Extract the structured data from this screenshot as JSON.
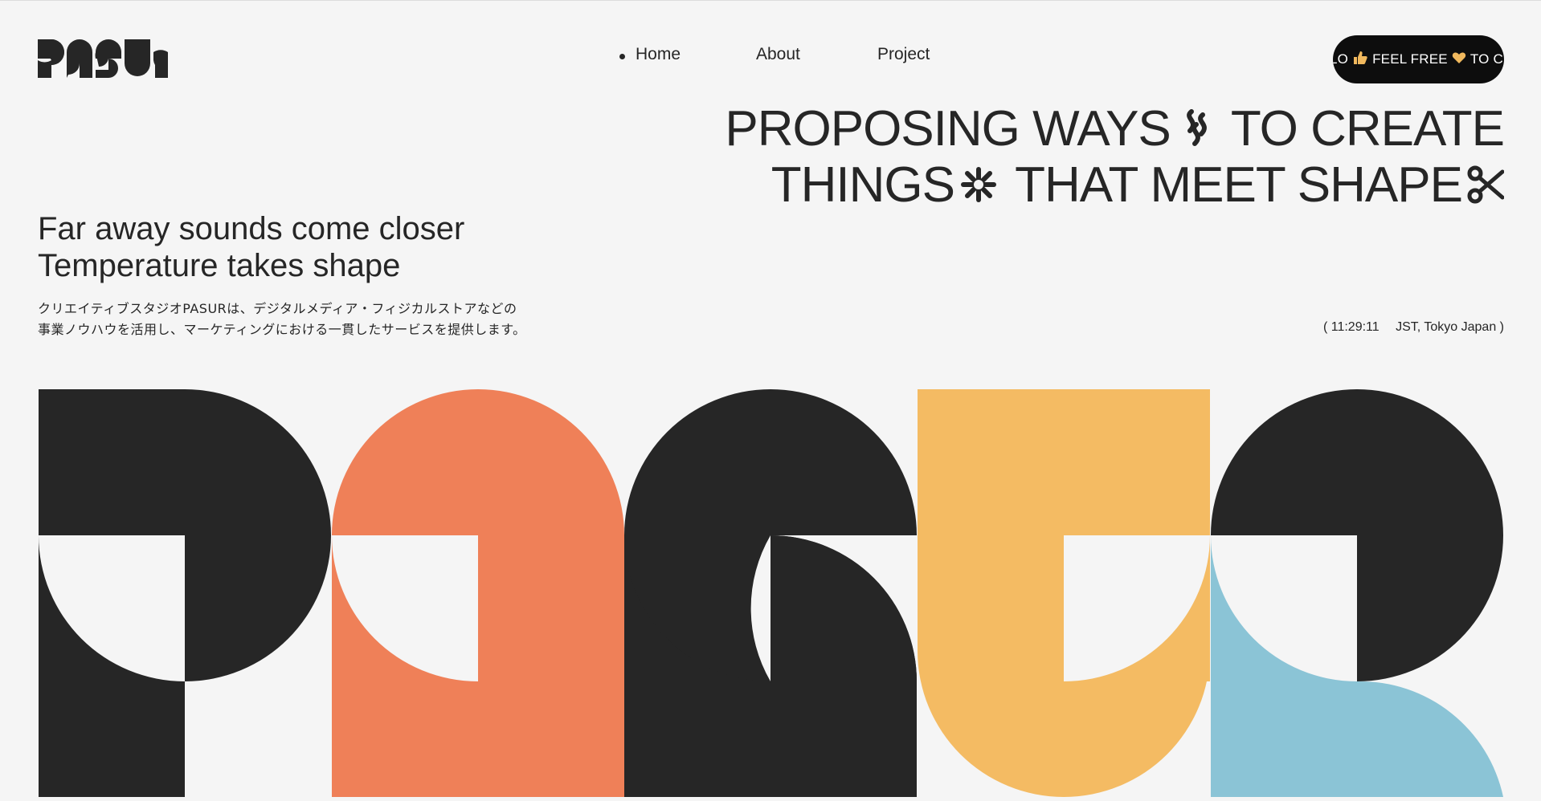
{
  "brand": {
    "logo_text": "PASUR"
  },
  "nav": {
    "items": [
      {
        "label": "Home",
        "active": true
      },
      {
        "label": "About",
        "active": false
      },
      {
        "label": "Project",
        "active": false
      }
    ]
  },
  "marquee": {
    "segments": [
      "LO",
      "FEEL FREE",
      "TO C"
    ],
    "icons": [
      "thumbs-up-icon",
      "heart-icon"
    ]
  },
  "headline": {
    "line1_a": "PROPOSING WAYS",
    "line1_b": "TO CREATE",
    "line2_a": "THINGS",
    "line2_b": "THAT MEET SHAPE",
    "icons": [
      "wave-icon",
      "asterisk-icon",
      "scissors-icon"
    ]
  },
  "tagline": {
    "line1": "Far away sounds come closer",
    "line2": "Temperature takes shape"
  },
  "description": {
    "line1": "クリエイティブスタジオPASURは、デジタルメディア・フィジカルストアなどの",
    "line2": "事業ノウハウを活用し、マーケティングにおける一貫したサービスを提供します。"
  },
  "clock": {
    "open": "(",
    "time": "11:29:11",
    "zone": "JST, Tokyo Japan",
    "close": ")"
  },
  "colors": {
    "background": "#f5f5f5",
    "ink": "#262626",
    "orange": "#ef8058",
    "yellow": "#f4bb63",
    "blue": "#8bc4d6",
    "pill": "#0d0d0d"
  }
}
